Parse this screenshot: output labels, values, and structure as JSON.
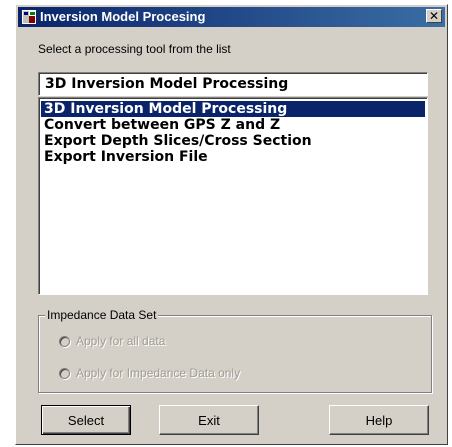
{
  "window": {
    "title": "Inversion Model Procesing",
    "close_label": "✕"
  },
  "prompt": "Select a processing tool from the list",
  "combo": {
    "selected": "3D Inversion Model Processing"
  },
  "list": {
    "items": [
      "3D Inversion Model Processing",
      "Convert between GPS Z and Z",
      "Export Depth Slices/Cross Section",
      "Export Inversion File"
    ],
    "selected_index": 0
  },
  "impedance_group": {
    "title": "Impedance Data Set",
    "options": [
      "Apply for all data",
      "Apply for Impedance Data only"
    ]
  },
  "buttons": {
    "select": "Select",
    "exit": "Exit",
    "help": "Help"
  },
  "colors": {
    "title_bar": "#0a246a",
    "selection": "#0a246a",
    "face": "#d4d0c8"
  }
}
